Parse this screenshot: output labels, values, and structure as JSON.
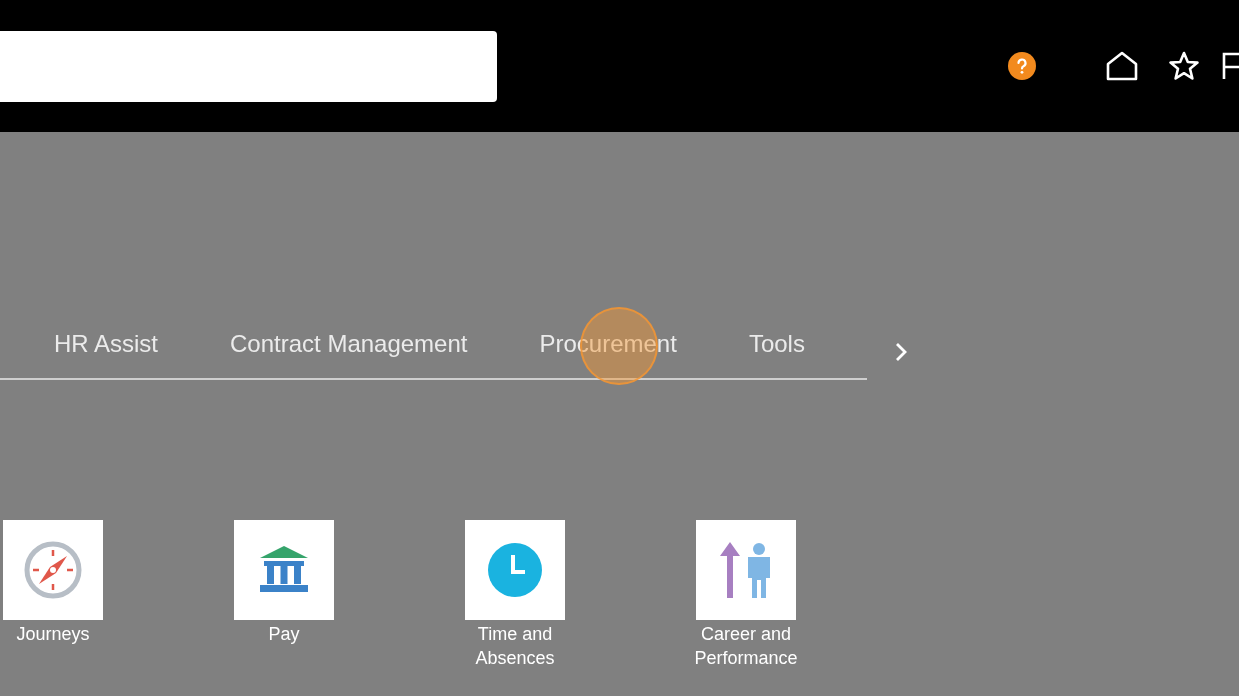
{
  "header": {
    "icons": [
      {
        "kind": "help"
      },
      {
        "kind": "home"
      },
      {
        "kind": "star"
      },
      {
        "kind": "flag"
      }
    ]
  },
  "tabs": [
    {
      "label": "HR Assist",
      "selected": false
    },
    {
      "label": "Contract Management",
      "selected": false
    },
    {
      "label": "Procurement",
      "selected": false
    },
    {
      "label": "Tools",
      "selected": false
    }
  ],
  "apps": [
    {
      "label": "Journeys",
      "kind": "compass"
    },
    {
      "label": "Pay",
      "kind": "bank"
    },
    {
      "label": "Time and Absences",
      "kind": "clock"
    },
    {
      "label": "Career and Performance",
      "kind": "career"
    }
  ]
}
